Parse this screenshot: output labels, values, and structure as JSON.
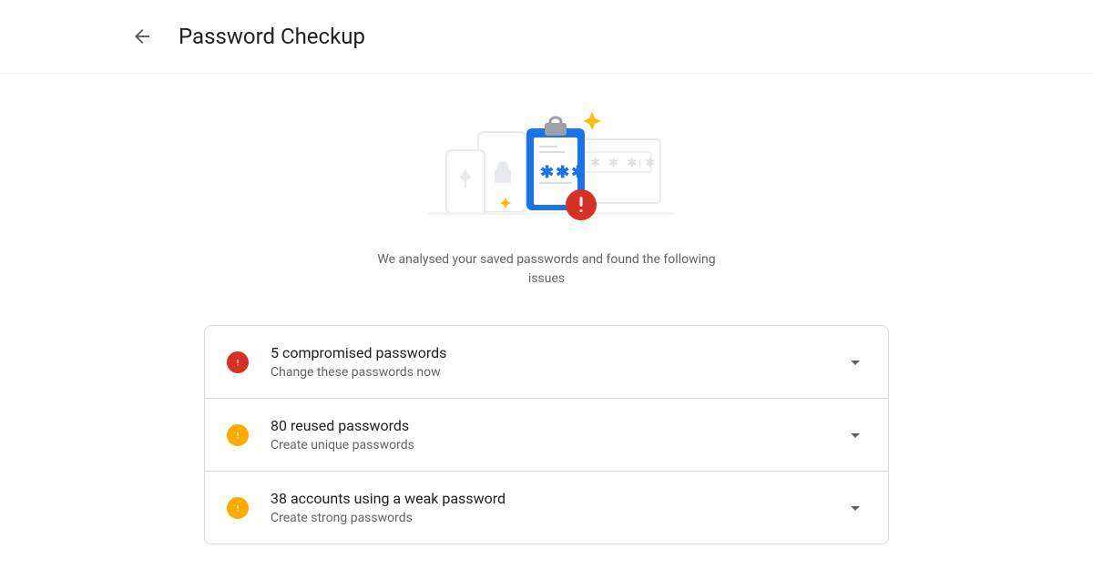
{
  "header": {
    "title": "Password Checkup"
  },
  "summary": {
    "text": "We analysed your saved passwords and found the following issues"
  },
  "issues": [
    {
      "severity": "red",
      "title": "5 compromised passwords",
      "subtitle": "Change these passwords now"
    },
    {
      "severity": "yellow",
      "title": "80 reused passwords",
      "subtitle": "Create unique passwords"
    },
    {
      "severity": "yellow",
      "title": "38 accounts using a weak password",
      "subtitle": "Create strong passwords"
    }
  ]
}
